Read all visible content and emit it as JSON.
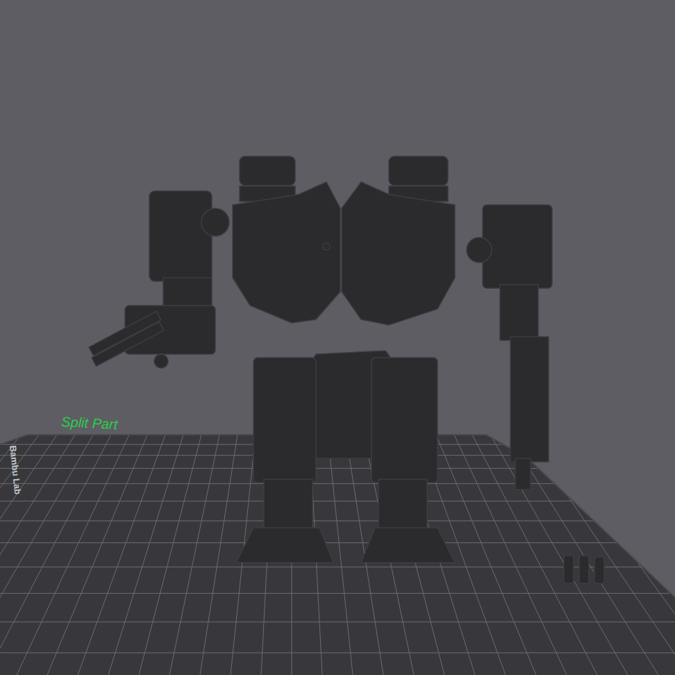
{
  "viewport": {
    "plate_label": "Split Part",
    "bed_brand": "Bambu Lab"
  }
}
